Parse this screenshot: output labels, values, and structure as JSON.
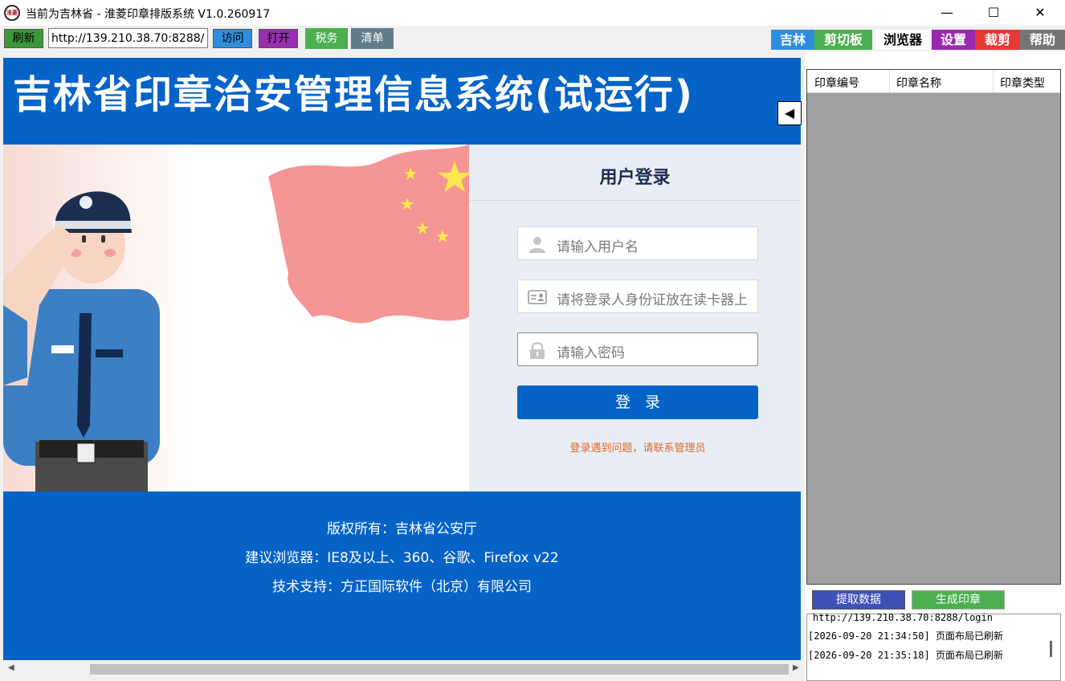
{
  "window": {
    "title": "当前为吉林省 - 淮菱印章排版系统 V1.0.260917",
    "icon_text": "淮菱",
    "controls": {
      "minimize": "—",
      "maximize": "☐",
      "close": "✕"
    }
  },
  "toolbar": {
    "refresh": "刷新",
    "url": "http://139.210.38.70:8288/",
    "visit": "访问",
    "open": "打开",
    "tax": "税务",
    "list": "清单",
    "colors": {
      "refresh": "#3a9a3a",
      "visit": "#2f8de0",
      "open": "#9a2fb0",
      "tax": "#4caf50",
      "list": "#607d8b"
    }
  },
  "nav_tabs": [
    {
      "label": "吉林",
      "color": "#2f8de0"
    },
    {
      "label": "剪切板",
      "color": "#4caf50"
    },
    {
      "label": "浏览器",
      "color": "#ffffff"
    },
    {
      "label": "设置",
      "color": "#9c27b0"
    },
    {
      "label": "裁剪",
      "color": "#e53935"
    },
    {
      "label": "帮助",
      "color": "#757575"
    }
  ],
  "site": {
    "title": "吉林省印章治安管理信息系统(试运行)",
    "collapse_icon": "◀",
    "login": {
      "title": "用户登录",
      "username_placeholder": "请输入用户名",
      "idcard_placeholder": "请将登录人身份证放在读卡器上",
      "password_placeholder": "请输入密码",
      "submit": "登录",
      "help": "登录遇到问题，请联系管理员"
    },
    "footer": {
      "copyright": "版权所有：吉林省公安厅",
      "browser": "建议浏览器：IE8及以上、360、谷歌、Firefox v22",
      "support": "技术支持：方正国际软件（北京）有限公司"
    },
    "accent": "#0563c8"
  },
  "seal_table": {
    "columns": [
      "印章编号",
      "印章名称",
      "印章类型"
    ]
  },
  "actions": {
    "extract": "提取数据",
    "generate": "生成印章"
  },
  "log": [
    "http://139.210.38.70:8288/login",
    "[2026-09-20 21:34:50] 页面布局已刷新",
    "[2026-09-20 21:35:18] 页面布局已刷新"
  ]
}
